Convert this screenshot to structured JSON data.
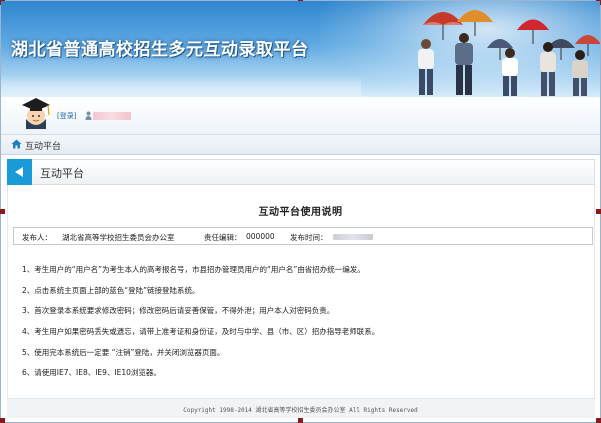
{
  "banner": {
    "title": "湖北省普通高校招生多元互动录取平台"
  },
  "user": {
    "login_link": "[登录]",
    "icon": "user-icon"
  },
  "breadcrumb": {
    "icon": "home-icon",
    "text": "互动平台"
  },
  "section": {
    "title": "互动平台",
    "toggle_icon": "triangle-left-icon",
    "accent_color": "#1a9ad6"
  },
  "article": {
    "title": "互动平台使用说明",
    "publisher_label": "发布人：",
    "publisher": "湖北省高等学校招生委员会办公室",
    "editor_label": "责任编辑：",
    "editor": "000000",
    "time_label": "发布时间：",
    "items": [
      "1、考生用户的“用户名”为考生本人的高考报名号，市县招办管理员用户的“用户名”由省招办统一编发。",
      "2、点击系统主页面上部的蓝色“登陆”链接登陆系统。",
      "3、首次登录本系统要求修改密码；修改密码后请妥善保管，不得外泄；用户本人对密码负责。",
      "4、考生用户如果密码丢失或遗忘，请带上准考证和身份证，及时与中学、县（市、区）招办指导老师联系。",
      "5、使用完本系统后一定要 “注销”登陆，并关闭浏览器页面。",
      "6、请使用IE7、IE8、IE9、IE10浏览器。"
    ]
  },
  "footer": {
    "text": "Copyright 1998-2014 湖北省高等学校招生委员会办公室 All Rights Reserved"
  }
}
